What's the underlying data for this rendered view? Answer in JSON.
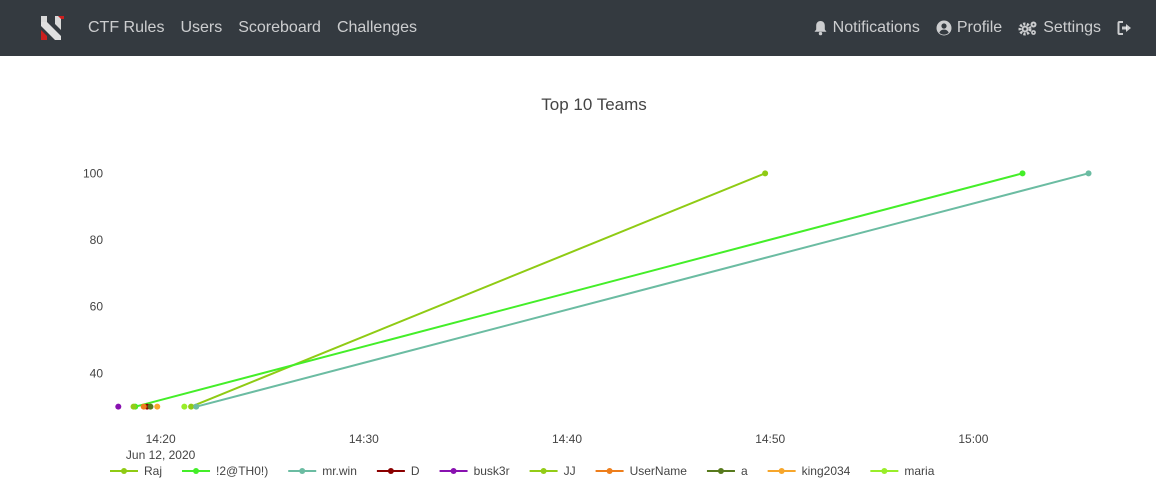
{
  "nav": {
    "left": [
      {
        "label": "CTF Rules",
        "name": "nav-ctf-rules"
      },
      {
        "label": "Users",
        "name": "nav-users"
      },
      {
        "label": "Scoreboard",
        "name": "nav-scoreboard"
      },
      {
        "label": "Challenges",
        "name": "nav-challenges"
      }
    ],
    "notifications": "Notifications",
    "profile": "Profile",
    "settings": "Settings"
  },
  "chart_data": {
    "type": "line",
    "title": "Top 10 Teams",
    "x_ticks": [
      "14:20",
      "14:30",
      "14:40",
      "14:50",
      "15:00"
    ],
    "x_date_label": "Jun 12, 2020",
    "x_range": [
      "14:18",
      "15:05"
    ],
    "y_ticks": [
      40,
      60,
      80,
      100
    ],
    "ylim": [
      26,
      104
    ],
    "grid": false,
    "legend_position": "bottom",
    "series": [
      {
        "name": "Raj",
        "color": "#8fcb14",
        "points": [
          [
            "14:21:30",
            30
          ],
          [
            "14:49:45",
            100
          ]
        ]
      },
      {
        "name": "!2@TH0!)",
        "color": "#44ee29",
        "points": [
          [
            "14:18:45",
            30
          ],
          [
            "15:02:25",
            100
          ]
        ]
      },
      {
        "name": "mr.win",
        "color": "#6bbca2",
        "points": [
          [
            "14:21:45",
            30
          ],
          [
            "15:05:40",
            100
          ]
        ]
      },
      {
        "name": "D",
        "color": "#8b0000",
        "points": [
          [
            "14:19:20",
            30
          ]
        ]
      },
      {
        "name": "busk3r",
        "color": "#8811b0",
        "points": [
          [
            "14:17:55",
            30
          ]
        ]
      },
      {
        "name": "JJ",
        "color": "#93cc17",
        "points": [
          [
            "14:18:40",
            30
          ]
        ]
      },
      {
        "name": "UserName",
        "color": "#ee7e1b",
        "points": [
          [
            "14:19:10",
            30
          ]
        ]
      },
      {
        "name": "a",
        "color": "#577a1d",
        "points": [
          [
            "14:19:30",
            30
          ]
        ]
      },
      {
        "name": "king2034",
        "color": "#f7a62b",
        "points": [
          [
            "14:19:50",
            30
          ]
        ]
      },
      {
        "name": "maria",
        "color": "#99ee29",
        "points": [
          [
            "14:21:10",
            30
          ]
        ]
      }
    ]
  }
}
